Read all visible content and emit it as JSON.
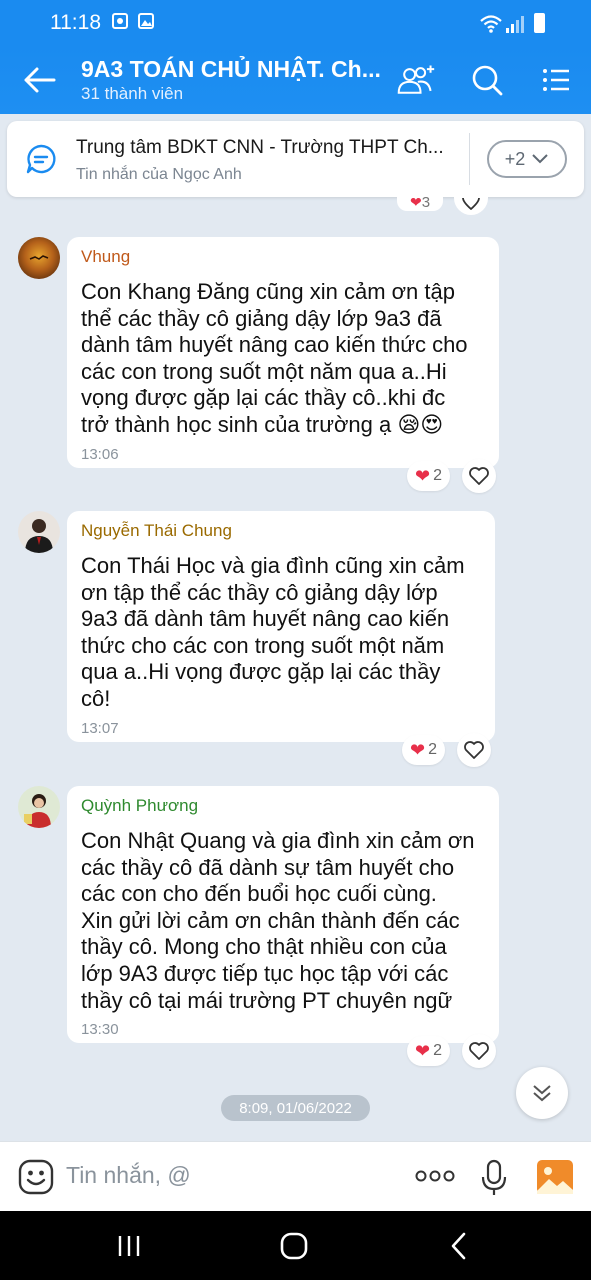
{
  "status_bar": {
    "time": "11:18"
  },
  "header": {
    "title": "9A3 TOÁN CHỦ NHẬT. Ch...",
    "subtitle": "31 thành viên"
  },
  "pinned": {
    "title": "Trung tâm BDKT CNN - Trường THPT Ch...",
    "subtitle": "Tin nhắn của Ngọc Anh",
    "more_label": "+2"
  },
  "top_reaction": {
    "count": "3"
  },
  "messages": [
    {
      "sender": "Vhung",
      "sender_color": "#c0591a",
      "lines": [
        "Con Khang Đăng cũng xin cảm ơn tập",
        "thể các thầy cô giảng dậy lớp 9a3 đã",
        "dành tâm huyết nâng cao kiến thức cho",
        "các con trong suốt một năm qua a..Hi",
        "vọng được gặp lại các thầy cô..khi đc",
        "trở thành học sinh của trường ạ"
      ],
      "emoji": "😪😍",
      "time": "13:06",
      "reactions": "2"
    },
    {
      "sender": "Nguyễn Thái Chung",
      "sender_color": "#9a6a00",
      "lines": [
        "Con Thái Học và gia đình cũng xin cảm",
        "ơn tập thể các thầy cô giảng dậy lớp",
        "9a3 đã dành tâm huyết nâng cao kiến",
        "thức cho các con trong suốt một năm",
        "qua a..Hi vọng được gặp lại các thầy",
        "cô!"
      ],
      "time": "13:07",
      "reactions": "2"
    },
    {
      "sender": "Quỳnh Phương",
      "sender_color": "#2f8a2f",
      "lines": [
        "Con Nhật Quang và gia đình xin cảm ơn",
        "các thầy cô đã dành sự tâm huyết cho",
        "các con cho đến buổi học cuối cùng.",
        "Xin gửi lời cảm ơn chân thành đến các",
        "thầy cô. Mong cho thật nhiều con của",
        "lớp 9A3 được tiếp tục học tập với  các",
        "thầy cô tại mái trường PT chuyên ngữ"
      ],
      "time": "13:30",
      "reactions": "2"
    }
  ],
  "date_chip": "8:09, 01/06/2022",
  "input": {
    "placeholder": "Tin nhắn, @"
  },
  "colors": {
    "header": "#1a8bf0",
    "background": "#e2e9f1",
    "heart": "#e8304a"
  },
  "icons": [
    "back-arrow-icon",
    "add-member-icon",
    "search-icon",
    "menu-list-icon",
    "chat-bubble-icon",
    "chevron-down-icon",
    "heart-icon",
    "double-chevron-down-icon",
    "sticker-icon",
    "more-icon",
    "microphone-icon",
    "image-icon"
  ]
}
